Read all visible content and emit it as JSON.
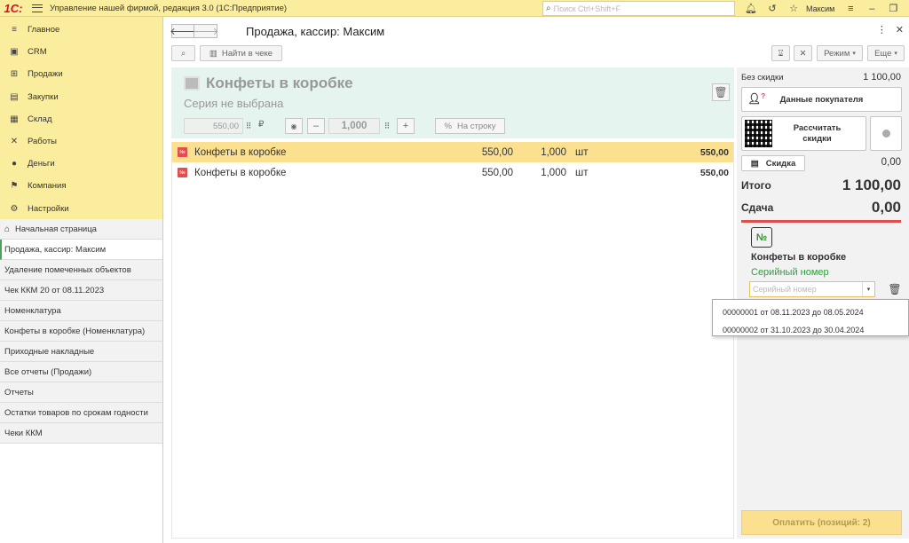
{
  "app": {
    "logo": "1С:",
    "title": "Управление нашей фирмой, редакция 3.0  (1С:Предприятие)",
    "search_placeholder": "Поиск Ctrl+Shift+F",
    "user": "Максим"
  },
  "nav": [
    {
      "label": "Главное",
      "icon": "menu-lines-icon",
      "glyph": "≡"
    },
    {
      "label": "CRM",
      "icon": "crm-icon",
      "glyph": "▣"
    },
    {
      "label": "Продажи",
      "icon": "cart-icon",
      "glyph": "⊞"
    },
    {
      "label": "Закупки",
      "icon": "box-icon",
      "glyph": "▤"
    },
    {
      "label": "Склад",
      "icon": "warehouse-icon",
      "glyph": "▦"
    },
    {
      "label": "Работы",
      "icon": "tools-icon",
      "glyph": "✕"
    },
    {
      "label": "Деньги",
      "icon": "money-icon",
      "glyph": "●"
    },
    {
      "label": "Компания",
      "icon": "flag-icon",
      "glyph": "⚑"
    },
    {
      "label": "Настройки",
      "icon": "gear-icon",
      "glyph": "⚙"
    }
  ],
  "open_windows": [
    {
      "label": "Начальная страница",
      "home": true
    },
    {
      "label": "Продажа, кассир: Максим",
      "active": true
    },
    {
      "label": "Удаление помеченных объектов"
    },
    {
      "label": "Чек ККМ 20 от 08.11.2023"
    },
    {
      "label": "Номенклатура"
    },
    {
      "label": "Конфеты в коробке (Номенклатура)"
    },
    {
      "label": "Приходные накладные"
    },
    {
      "label": "Все отчеты (Продажи)"
    },
    {
      "label": "Отчеты"
    },
    {
      "label": "Остатки товаров по срокам годности"
    },
    {
      "label": "Чеки ККМ"
    }
  ],
  "page": {
    "title": "Продажа, кассир: Максим"
  },
  "toolbar": {
    "find_in_receipt": "Найти в чеке",
    "mode": "Режим",
    "more": "Еще"
  },
  "product": {
    "name": "Конфеты в коробке",
    "series": "Серия не выбрана",
    "price": "550,00",
    "currency": "₽",
    "quantity": "1,000",
    "to_line": "На строку"
  },
  "lines": [
    {
      "name": "Конфеты в коробке",
      "price": "550,00",
      "qty": "1,000",
      "unit": "шт",
      "sum": "550,00",
      "selected": true
    },
    {
      "name": "Конфеты в коробке",
      "price": "550,00",
      "qty": "1,000",
      "unit": "шт",
      "sum": "550,00",
      "selected": false
    }
  ],
  "summary": {
    "no_discount_label": "Без скидки",
    "no_discount_value": "1 100,00",
    "buyer_data": "Данные покупателя",
    "calc_discounts": "Рассчитать\nскидки",
    "discount_label": "Скидка",
    "discount_value": "0,00",
    "total_label": "Итого",
    "total_value": "1 100,00",
    "change_label": "Сдача",
    "change_value": "0,00",
    "num_badge": "№",
    "item_name": "Конфеты в коробке",
    "serial_label": "Серийный номер",
    "serial_placeholder": "Серийный номер",
    "pay_button": "Оплатить (позиций: 2)"
  },
  "serial_options": [
    "00000001 от 08.11.2023 до 08.05.2024",
    "00000002 от 31.10.2023 до 30.04.2024"
  ],
  "colors": {
    "topbar": "#fbed9e",
    "selected_row": "#fbe18f",
    "product_panel": "#e5f4ee",
    "accent_red": "#e04e4e",
    "serial_green": "#2e9e3e"
  }
}
